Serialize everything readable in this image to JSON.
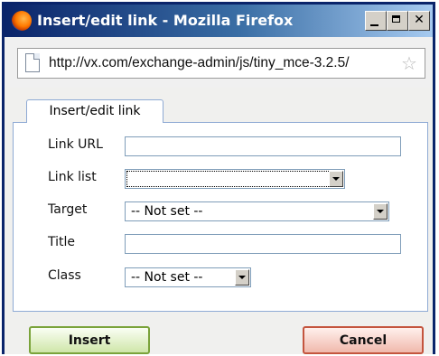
{
  "window": {
    "title": "Insert/edit link - Mozilla Firefox",
    "url": "http://vx.com/exchange-admin/js/tiny_mce-3.2.5/",
    "icons": {
      "app": "firefox-icon",
      "page": "page-icon",
      "bookmark": "star-icon"
    },
    "controls": [
      "minimize",
      "maximize",
      "close"
    ]
  },
  "dialog": {
    "tab_label": "Insert/edit link",
    "fields": {
      "link_url": {
        "label": "Link URL",
        "value": ""
      },
      "link_list": {
        "label": "Link list",
        "value": ""
      },
      "target": {
        "label": "Target",
        "value": "-- Not set --"
      },
      "title": {
        "label": "Title",
        "value": ""
      },
      "class": {
        "label": "Class",
        "value": "-- Not set --"
      }
    },
    "buttons": {
      "insert": "Insert",
      "cancel": "Cancel"
    }
  },
  "colors": {
    "titlebar": "#0a246a",
    "insert_button": "#cfe6a9",
    "cancel_button": "#f0b9ac",
    "tab_border": "#8eaad4"
  }
}
